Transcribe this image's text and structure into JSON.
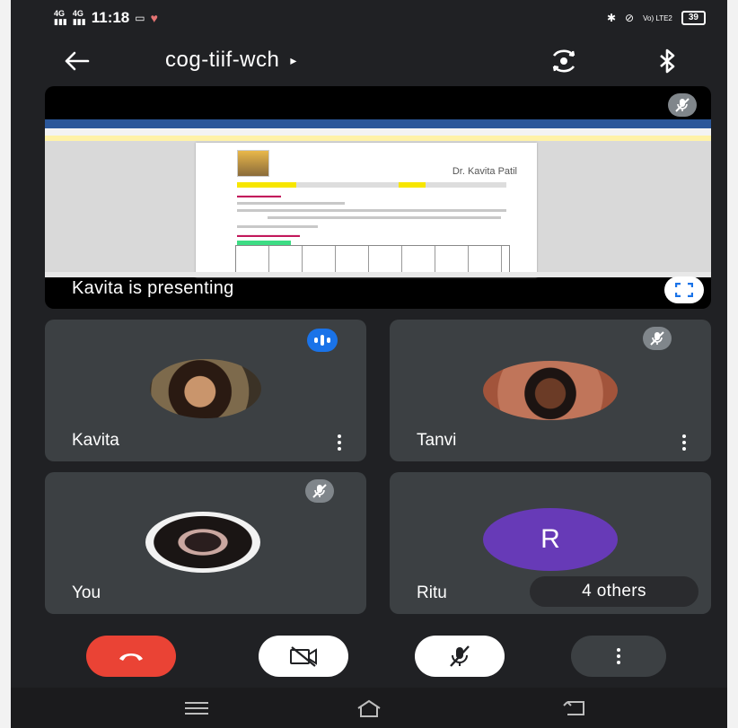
{
  "status_bar": {
    "network_1": "4G",
    "network_2": "4G",
    "time": "11:18",
    "vowifi": "Vo) LTE2",
    "battery": "39"
  },
  "app_bar": {
    "meeting_code": "cog-tiif-wch",
    "caret": "▸"
  },
  "presentation": {
    "label": "Kavita is presenting",
    "doc_name": "Dr. Kavita Patil"
  },
  "participants": [
    {
      "name": "Kavita",
      "state": "speaking"
    },
    {
      "name": "Tanvi",
      "state": "muted"
    },
    {
      "name": "You",
      "state": "muted"
    },
    {
      "name": "Ritu",
      "initial": "R",
      "others_label": "4 others"
    }
  ],
  "colors": {
    "background": "#202124",
    "tile": "#3c4043",
    "end_call": "#ea4335",
    "speaking": "#1a73e8",
    "avatar_r": "#673ab7"
  }
}
